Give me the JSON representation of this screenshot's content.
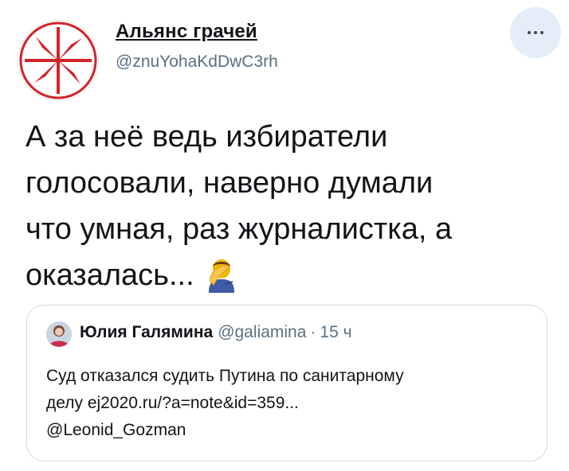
{
  "author": {
    "display_name": "Альянс грачей",
    "handle": "@znuYohaKdDwC3rh"
  },
  "tweet": {
    "lines": [
      "А за неё ведь избиратели",
      "голосовали, наверно думали",
      "что умная, раз журналистка, а",
      "оказалась..."
    ],
    "emoji": "facepalm-icon"
  },
  "quote": {
    "name": "Юлия Галямина",
    "handle": "@galiamina",
    "separator": "·",
    "time": "15 ч",
    "lines": [
      "Суд отказался судить Путина по санитарному",
      "делу ej2020.ru/?a=note&id=359...",
      "@Leonid_Gozman"
    ]
  },
  "colors": {
    "accent_red": "#d1232a",
    "secondary_text": "#5b7083",
    "more_button_bg": "#e3eef9",
    "card_border": "#cfd9de"
  }
}
